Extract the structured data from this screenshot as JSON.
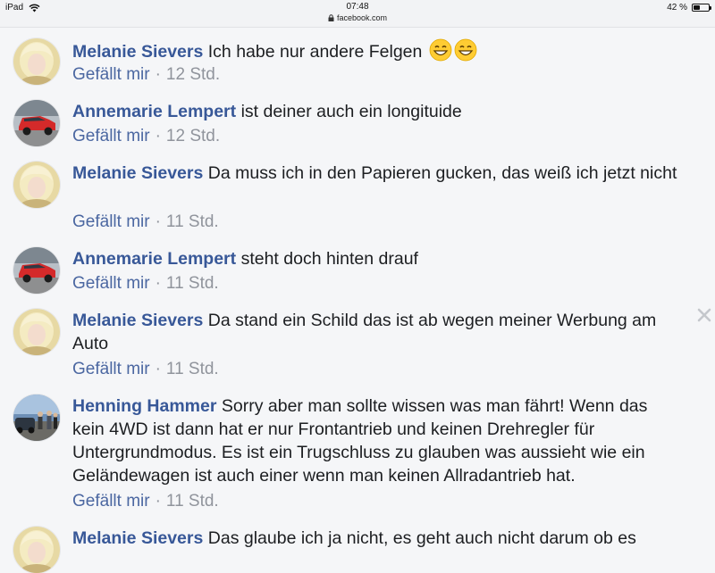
{
  "status_bar": {
    "device": "iPad",
    "time": "07:48",
    "url": "facebook.com",
    "battery": "42 %",
    "battery_level": 0.42
  },
  "comments": [
    {
      "author": "Melanie Sievers",
      "text": "Ich habe nur andere Felgen",
      "emoji": "grinning-face-emoji x2",
      "like_label": "Gefällt mir",
      "separator": "·",
      "time": "12 Std.",
      "avatar": "blonde-woman-avatar"
    },
    {
      "author": "Annemarie Lempert",
      "text": "ist deiner auch ein longituide",
      "like_label": "Gefällt mir",
      "separator": "·",
      "time": "12 Std.",
      "avatar": "red-car-avatar"
    },
    {
      "author": "Melanie Sievers",
      "text": "Da muss ich in den Papieren gucken, das weiß ich jetzt nicht",
      "like_label": "Gefällt mir",
      "separator": "·",
      "time": "11 Std.",
      "avatar": "blonde-woman-avatar"
    },
    {
      "author": "Annemarie Lempert",
      "text": "steht doch hinten drauf",
      "like_label": "Gefällt mir",
      "separator": "·",
      "time": "11 Std.",
      "avatar": "red-car-avatar"
    },
    {
      "author": "Melanie Sievers",
      "text": "Da stand ein Schild das ist ab wegen meiner Werbung am Auto",
      "like_label": "Gefällt mir",
      "separator": "·",
      "time": "11 Std.",
      "avatar": "blonde-woman-avatar"
    },
    {
      "author": "Henning Hammer",
      "text": "Sorry aber man sollte wissen was man fährt! Wenn das kein 4WD ist dann hat er nur Frontantrieb und keinen Drehregler für Untergrundmodus. Es ist ein Trugschluss zu glauben was aussieht wie ein Geländewagen ist auch einer wenn man keinen Allradantrieb hat.",
      "like_label": "Gefällt mir",
      "separator": "·",
      "time": "11 Std.",
      "avatar": "group-photo-avatar"
    },
    {
      "author": "Melanie Sievers",
      "text": "Das glaube ich ja nicht, es geht auch nicht darum ob es",
      "avatar": "blonde-woman-avatar"
    }
  ],
  "icons": {
    "close": "close-icon",
    "wifi": "wifi-icon",
    "lock": "lock-icon",
    "battery": "battery-icon",
    "emoji": "grinning-face-emoji"
  },
  "colors": {
    "author": "#385898",
    "like": "#4b67a1",
    "meta": "#90949c",
    "text": "#1c1e21",
    "background": "#f5f6f8"
  }
}
